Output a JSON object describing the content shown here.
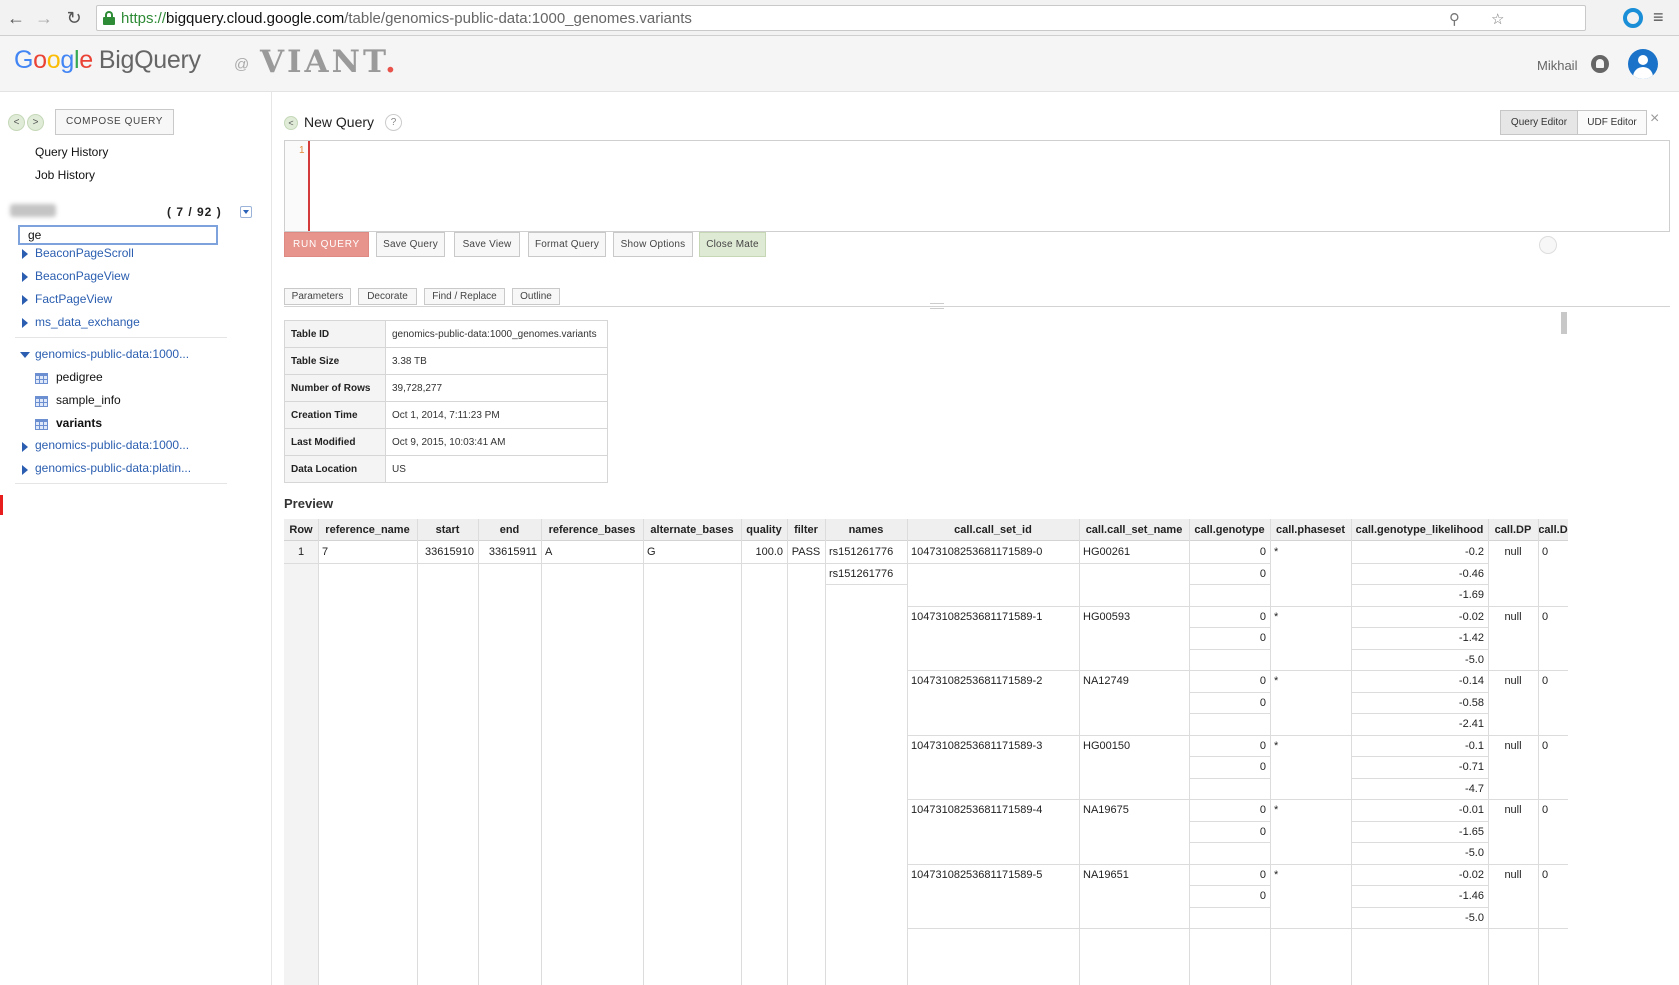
{
  "browser": {
    "url_scheme": "https://",
    "url_host": "bigquery.cloud.google.com",
    "url_path": "/table/genomics-public-data:1000_genomes.variants"
  },
  "header": {
    "logo_google": [
      "G",
      "o",
      "o",
      "g",
      "l",
      "e"
    ],
    "logo_product": "BigQuery",
    "at": "@",
    "org_logo": "VIANT",
    "org_logo_dot": ".",
    "user": "Mikhail"
  },
  "sidebar": {
    "prev": "<",
    "next": ">",
    "compose_label": "COMPOSE QUERY",
    "query_history": "Query History",
    "job_history": "Job History",
    "dataset_count": "( 7 / 92 )",
    "filter_value": "ge",
    "datasets_collapsed": [
      "BeaconPageScroll",
      "BeaconPageView",
      "FactPageView",
      "ms_data_exchange"
    ],
    "expanded_dataset": "genomics-public-data:1000...",
    "tables": [
      "pedigree",
      "sample_info",
      "variants"
    ],
    "selected_table": "variants",
    "more_datasets": [
      "genomics-public-data:1000...",
      "genomics-public-data:platin..."
    ]
  },
  "query": {
    "collapse": "<",
    "title": "New Query",
    "help": "?",
    "tab_query_editor": "Query Editor",
    "tab_udf_editor": "UDF Editor",
    "close": "×",
    "line_number": "1",
    "buttons": {
      "run": "RUN QUERY",
      "save_query": "Save Query",
      "save_view": "Save View",
      "format_query": "Format Query",
      "show_options": "Show Options",
      "close_mate": "Close Mate"
    },
    "small_buttons": {
      "parameters": "Parameters",
      "decorate": "Decorate",
      "find_replace": "Find / Replace",
      "outline": "Outline"
    }
  },
  "table_info": [
    {
      "key": "Table ID",
      "value": "genomics-public-data:1000_genomes.variants"
    },
    {
      "key": "Table Size",
      "value": "3.38 TB"
    },
    {
      "key": "Number of Rows",
      "value": "39,728,277"
    },
    {
      "key": "Creation Time",
      "value": "Oct 1, 2014, 7:11:23 PM"
    },
    {
      "key": "Last Modified",
      "value": "Oct 9, 2015, 10:03:41 AM"
    },
    {
      "key": "Data Location",
      "value": "US"
    }
  ],
  "preview": {
    "title": "Preview",
    "columns": [
      "Row",
      "reference_name",
      "start",
      "end",
      "reference_bases",
      "alternate_bases",
      "quality",
      "filter",
      "names",
      "call.call_set_id",
      "call.call_set_name",
      "call.genotype",
      "call.phaseset",
      "call.genotype_likelihood",
      "call.DP",
      "call.D"
    ],
    "row": {
      "row": "1",
      "reference_name": "7",
      "start": "33615910",
      "end": "33615911",
      "reference_bases": "A",
      "alternate_bases": "G",
      "quality": "100.0",
      "filter": "PASS",
      "names": [
        "rs151261776",
        "rs151261776"
      ]
    },
    "calls": [
      {
        "id": "10473108253681171589-0",
        "name": "HG00261",
        "genotype": [
          "0",
          "0"
        ],
        "phaseset": "*",
        "likelihood": [
          "-0.2",
          "-0.46",
          "-1.69"
        ],
        "dp": "null",
        "extra": "0"
      },
      {
        "id": "10473108253681171589-1",
        "name": "HG00593",
        "genotype": [
          "0",
          "0"
        ],
        "phaseset": "*",
        "likelihood": [
          "-0.02",
          "-1.42",
          "-5.0"
        ],
        "dp": "null",
        "extra": "0"
      },
      {
        "id": "10473108253681171589-2",
        "name": "NA12749",
        "genotype": [
          "0",
          "0"
        ],
        "phaseset": "*",
        "likelihood": [
          "-0.14",
          "-0.58",
          "-2.41"
        ],
        "dp": "null",
        "extra": "0"
      },
      {
        "id": "10473108253681171589-3",
        "name": "HG00150",
        "genotype": [
          "0",
          "0"
        ],
        "phaseset": "*",
        "likelihood": [
          "-0.1",
          "-0.71",
          "-4.7"
        ],
        "dp": "null",
        "extra": "0"
      },
      {
        "id": "10473108253681171589-4",
        "name": "NA19675",
        "genotype": [
          "0",
          "0"
        ],
        "phaseset": "*",
        "likelihood": [
          "-0.01",
          "-1.65",
          "-5.0"
        ],
        "dp": "null",
        "extra": "0"
      },
      {
        "id": "10473108253681171589-5",
        "name": "NA19651",
        "genotype": [
          "0",
          "0"
        ],
        "phaseset": "*",
        "likelihood": [
          "-0.02",
          "-1.46",
          "-5.0"
        ],
        "dp": "null",
        "extra": "0"
      }
    ]
  },
  "colors": {
    "run_button": "#e7948c",
    "close_mate_button": "#dfead4",
    "link_blue": "#2b5eb0",
    "selected_marker": "#e81d1d"
  },
  "icons": [
    "back-arrow-icon",
    "forward-arrow-icon",
    "reload-icon",
    "lock-icon",
    "search-icon",
    "star-icon",
    "notification-icon",
    "avatar-icon",
    "table-icon",
    "expand-triangle-icon",
    "collapse-triangle-icon",
    "dropdown-icon",
    "close-icon"
  ]
}
